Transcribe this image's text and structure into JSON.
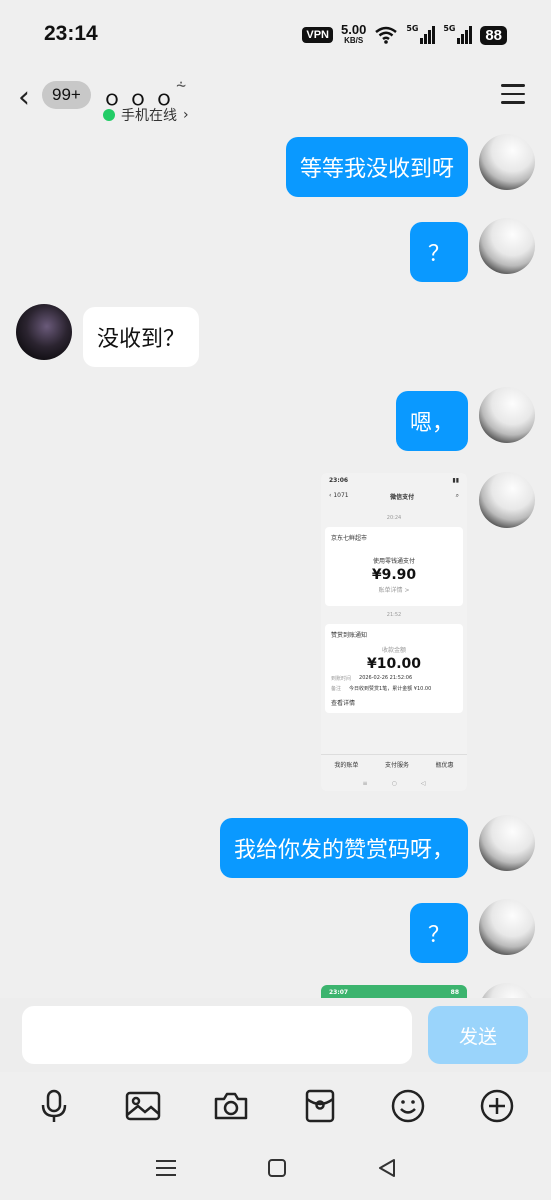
{
  "status_bar": {
    "time": "23:14",
    "vpn": "VPN",
    "speed_value": "5.00",
    "speed_unit": "KB/S",
    "network_1": "5G",
    "network_2": "5G",
    "battery": "88"
  },
  "header": {
    "unread_badge": "99+",
    "contact_name": "ｏｏｏ",
    "online_status": "手机在线",
    "icons": {
      "back": "back-chevron-icon",
      "hearing": "ear-icon",
      "menu": "menu-icon",
      "status": "online-dot-icon"
    }
  },
  "messages": [
    {
      "sender": "me",
      "type": "text",
      "text": "等等我没收到呀"
    },
    {
      "sender": "me",
      "type": "text",
      "text": "？"
    },
    {
      "sender": "other",
      "type": "text",
      "text": "没收到？"
    },
    {
      "sender": "me",
      "type": "text",
      "text": "嗯，"
    },
    {
      "sender": "me",
      "type": "image",
      "screenshot": {
        "time": "23:06",
        "badge": "1071",
        "title": "微信支付",
        "timestamp_1": "20:24",
        "merchant": "京东七鲜超市",
        "pay_method": "使用零钱通支付",
        "amount_1": "¥9.90",
        "detail_link": "账单详情 >",
        "timestamp_2": "21:52",
        "card_title": "赞赏到账通知",
        "received_label": "收款金额",
        "amount_2": "¥10.00",
        "time_label": "到账时间",
        "time_value": "2026-02-26 21:52:06",
        "note_label": "备注",
        "note_value": "今日收到赞赏1笔，累计金额 ¥10.00",
        "view_detail": "查看详情",
        "footer_items": [
          "我的账单",
          "支付服务",
          "瓶优惠"
        ]
      }
    },
    {
      "sender": "me",
      "type": "text",
      "text": "我给你发的赞赏码呀，"
    },
    {
      "sender": "me",
      "type": "text",
      "text": "？"
    }
  ],
  "peek_screenshot": {
    "time": "23:07",
    "battery": "88"
  },
  "input_bar": {
    "placeholder": "",
    "send_label": "发送"
  },
  "toolbar_icons": [
    "microphone-icon",
    "image-icon",
    "camera-icon",
    "red-packet-icon",
    "emoji-icon",
    "plus-icon"
  ],
  "colors": {
    "bubble_me": "#0a99ff",
    "bubble_other": "#ffffff",
    "send_disabled": "#9ad4fb",
    "online": "#22cc66"
  }
}
